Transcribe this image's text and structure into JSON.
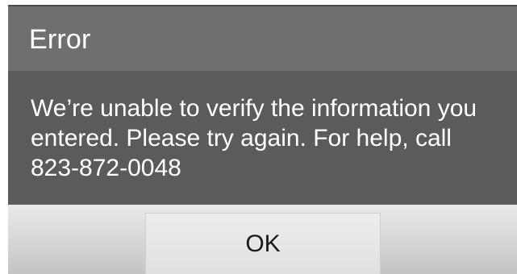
{
  "dialog": {
    "title": "Error",
    "message": "We’re unable to verify the information you entered. Please try again. For help, call 823-872-0048",
    "ok_label": "OK"
  }
}
